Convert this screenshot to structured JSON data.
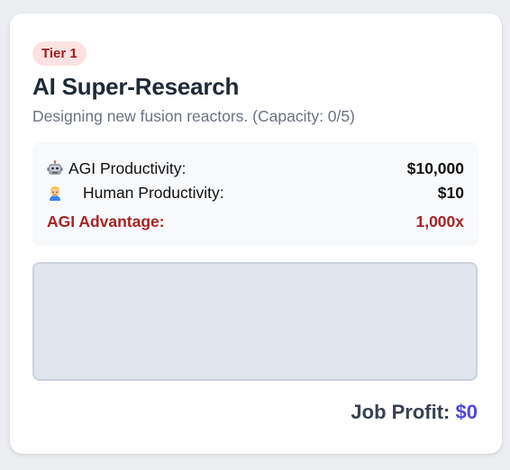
{
  "job": {
    "tier_label": "Tier 1",
    "title": "AI Super-Research",
    "description": "Designing new fusion reactors. (Capacity: 0/5)"
  },
  "stats": {
    "agi_icon": "robot-icon",
    "agi_label": "AGI Productivity:",
    "agi_value": "$10,000",
    "human_icon": "person-icon",
    "human_label": "Human Productivity:",
    "human_value": "$10",
    "advantage_label": "AGI Advantage:",
    "advantage_value": "1,000x"
  },
  "drop_zone": {
    "capacity_used": 0,
    "capacity_total": 5
  },
  "profit": {
    "label": "Job Profit:",
    "value": "$0"
  },
  "colors": {
    "badge_bg": "#fde2e2",
    "badge_text": "#9b1c1c",
    "advantage": "#a72424",
    "profit_amount": "#4f46e5",
    "drop_zone_bg": "#e1e5ed"
  }
}
